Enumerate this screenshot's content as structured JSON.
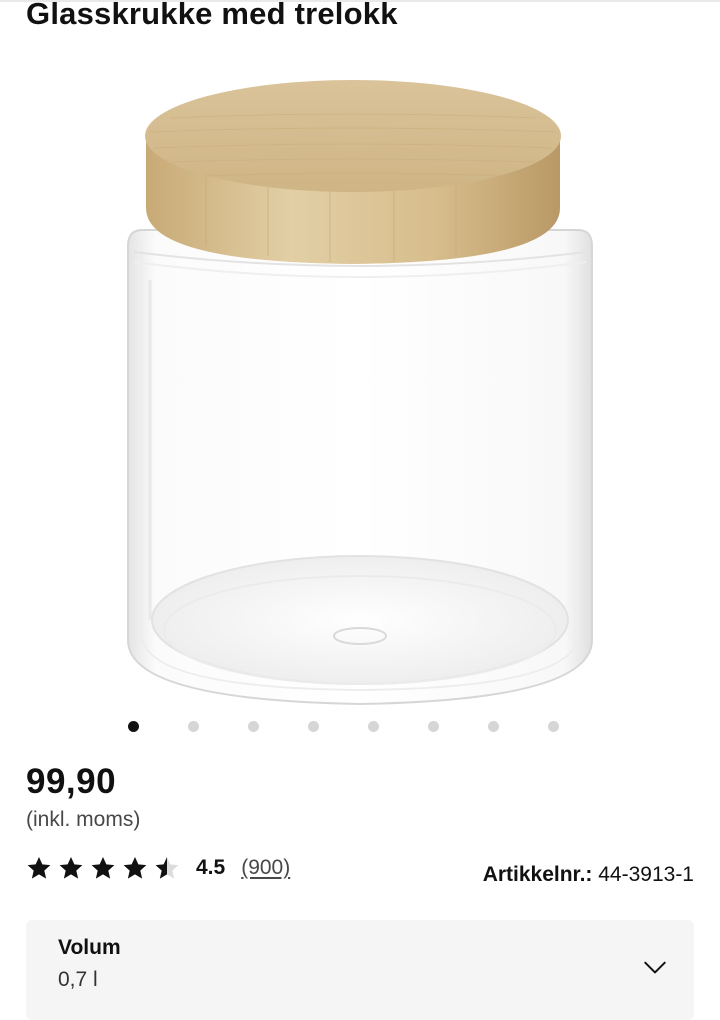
{
  "product": {
    "title": "Glasskrukke med trelokk",
    "image_icon": "glass-jar-with-bamboo-lid"
  },
  "gallery": {
    "total_images": 8,
    "active_index": 0
  },
  "pricing": {
    "price": "99,90",
    "vat_note": "(inkl. moms)"
  },
  "rating": {
    "stars": 4.5,
    "stars_max": 5,
    "value_text": "4.5",
    "count_text": "(900)"
  },
  "article": {
    "label": "Artikkelnr.:",
    "number": "44-3913-1"
  },
  "variant": {
    "label": "Volum",
    "value": "0,7 l",
    "icon": "chevron-down-icon"
  },
  "colors": {
    "text": "#111111",
    "muted": "#484848",
    "variant_bg": "#f5f5f5",
    "lid": "#d7bf8f",
    "dot_active": "#111111",
    "dot_inactive": "#d6d6d6"
  }
}
